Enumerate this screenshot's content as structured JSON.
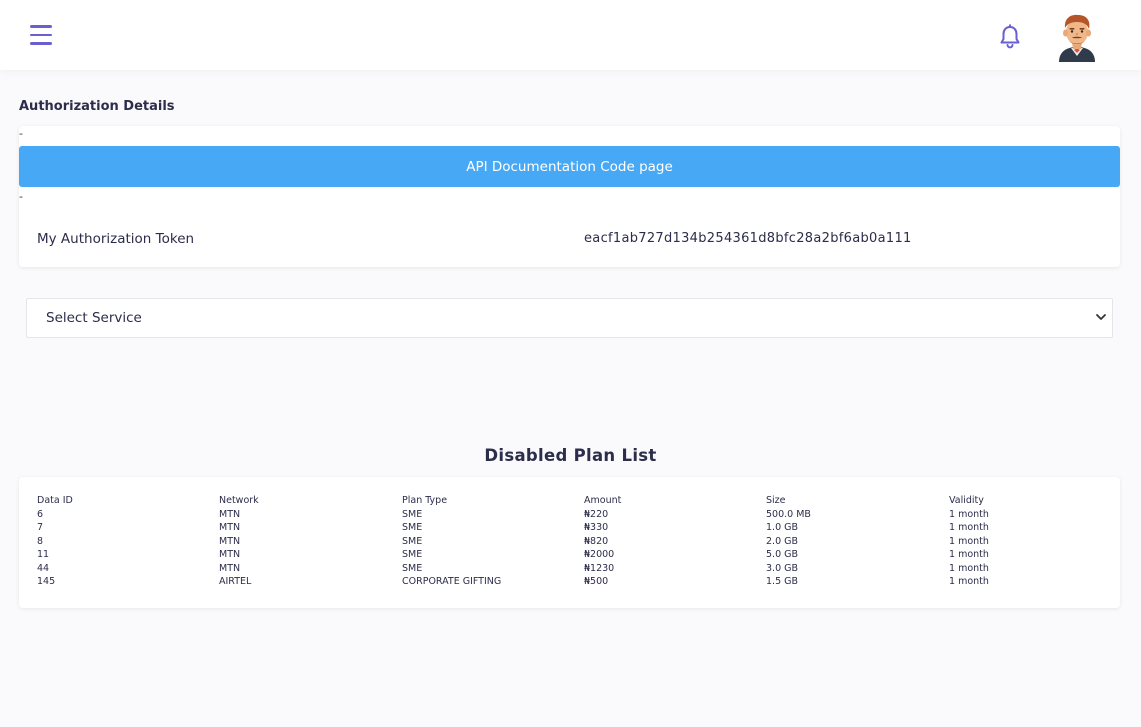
{
  "header": {
    "menu_icon": "hamburger-icon",
    "notification_icon": "bell-icon",
    "avatar_icon": "user-avatar"
  },
  "auth": {
    "section_title": "Authorization Details",
    "dash_top": "-",
    "api_button_label": "API Documentation Code page",
    "dash_bottom": "-",
    "token_label": "My Authorization Token",
    "token_value": "eacf1ab727d134b254361d8bfc28a2bf6ab0a111"
  },
  "service_select": {
    "selected": "Select Service",
    "icon": "chevron-down-icon"
  },
  "disabled_plans": {
    "title": "Disabled Plan List",
    "columns": [
      "Data ID",
      "Network",
      "Plan Type",
      "Amount",
      "Size",
      "Validity"
    ],
    "rows": [
      [
        "6",
        "MTN",
        "SME",
        "₦220",
        "500.0 MB",
        "1 month"
      ],
      [
        "7",
        "MTN",
        "SME",
        "₦330",
        "1.0 GB",
        "1 month"
      ],
      [
        "8",
        "MTN",
        "SME",
        "₦820",
        "2.0 GB",
        "1 month"
      ],
      [
        "11",
        "MTN",
        "SME",
        "₦2000",
        "5.0 GB",
        "1 month"
      ],
      [
        "44",
        "MTN",
        "SME",
        "₦1230",
        "3.0 GB",
        "1 month"
      ],
      [
        "145",
        "AIRTEL",
        "CORPORATE GIFTING",
        "₦500",
        "1.5 GB",
        "1 month"
      ]
    ]
  },
  "colors": {
    "accent": "#6a5fd2",
    "button": "#47a9f5",
    "text": "#2c2d4a"
  }
}
